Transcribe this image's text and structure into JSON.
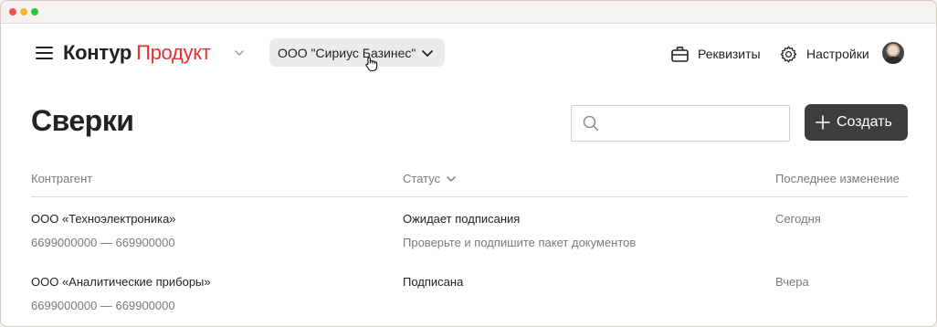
{
  "header": {
    "logo_brand": "Контур",
    "logo_product": "Продукт",
    "organization": "ООО \"Сириус Базинес\"",
    "requisites_label": "Реквизиты",
    "settings_label": "Настройки"
  },
  "page": {
    "title": "Сверки",
    "search_placeholder": "",
    "create_label": "Создать"
  },
  "table": {
    "columns": {
      "counterparty": "Контрагент",
      "status": "Статус",
      "last_change": "Последнее изменение"
    },
    "rows": [
      {
        "name": "ООО «Техноэлектроника»",
        "inn": "6699000000 — 669900000",
        "status": "Ожидает подписания",
        "hint": "Проверьте и подпишите пакет документов",
        "date": "Сегодня"
      },
      {
        "name": "ООО «Аналитические приборы»",
        "inn": "6699000000 — 669900000",
        "status": "Подписана",
        "hint": "",
        "date": "Вчера"
      }
    ]
  },
  "colors": {
    "brand_red": "#e3312d",
    "button_dark": "#3d3d3d",
    "muted_text": "#7a7a7a"
  },
  "icons": [
    "menu-icon",
    "chevron-down-icon",
    "briefcase-icon",
    "gear-icon",
    "search-icon",
    "plus-icon",
    "hand-cursor-icon"
  ]
}
